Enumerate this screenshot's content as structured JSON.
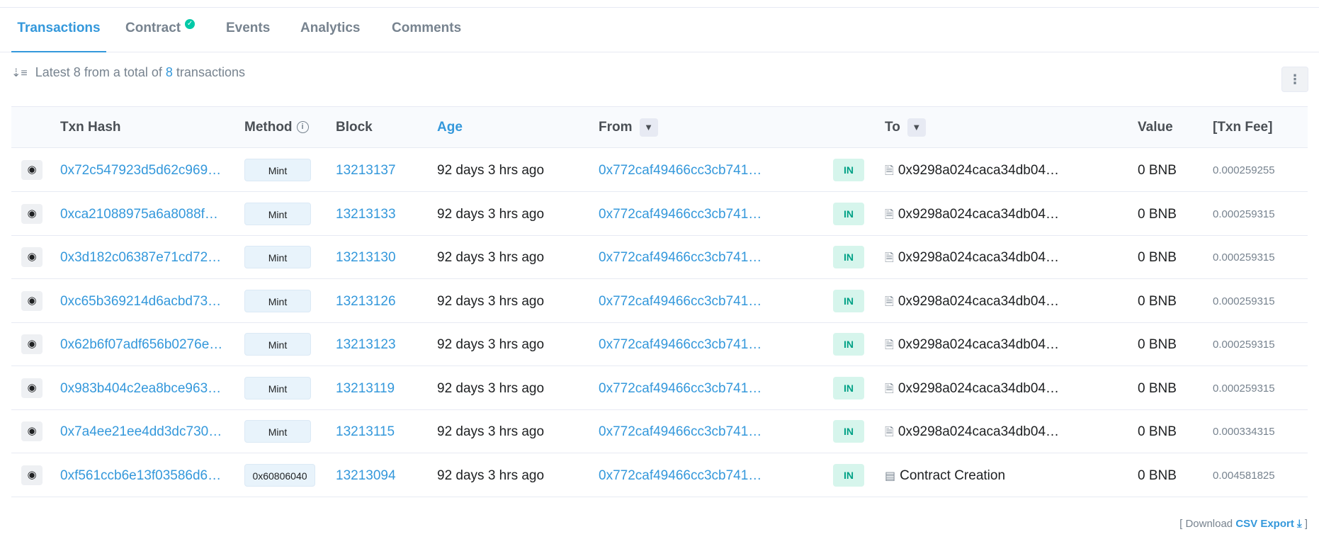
{
  "tabs": [
    {
      "label": "Transactions",
      "active": true
    },
    {
      "label": "Contract",
      "verified": true
    },
    {
      "label": "Events"
    },
    {
      "label": "Analytics"
    },
    {
      "label": "Comments"
    }
  ],
  "summary": {
    "prefix": "Latest 8 from a total of",
    "count": "8",
    "suffix": "transactions"
  },
  "more_icon": "⋮",
  "columns": {
    "txn_hash": "Txn Hash",
    "method": "Method",
    "block": "Block",
    "age": "Age",
    "from": "From",
    "to": "To",
    "value": "Value",
    "txn_fee": "[Txn Fee]"
  },
  "rows": [
    {
      "hash": "0x72c547923d5d62c969…",
      "method": "Mint",
      "block": "13213137",
      "age": "92 days 3 hrs ago",
      "from": "0x772caf49466cc3cb741…",
      "direction": "IN",
      "to": "0x9298a024caca34db04…",
      "to_icon": "file-icon",
      "value": "0 BNB",
      "fee": "0.000259255"
    },
    {
      "hash": "0xca21088975a6a8088f…",
      "method": "Mint",
      "block": "13213133",
      "age": "92 days 3 hrs ago",
      "from": "0x772caf49466cc3cb741…",
      "direction": "IN",
      "to": "0x9298a024caca34db04…",
      "to_icon": "file-icon",
      "value": "0 BNB",
      "fee": "0.000259315"
    },
    {
      "hash": "0x3d182c06387e71cd72…",
      "method": "Mint",
      "block": "13213130",
      "age": "92 days 3 hrs ago",
      "from": "0x772caf49466cc3cb741…",
      "direction": "IN",
      "to": "0x9298a024caca34db04…",
      "to_icon": "file-icon",
      "value": "0 BNB",
      "fee": "0.000259315"
    },
    {
      "hash": "0xc65b369214d6acbd73…",
      "method": "Mint",
      "block": "13213126",
      "age": "92 days 3 hrs ago",
      "from": "0x772caf49466cc3cb741…",
      "direction": "IN",
      "to": "0x9298a024caca34db04…",
      "to_icon": "file-icon",
      "value": "0 BNB",
      "fee": "0.000259315"
    },
    {
      "hash": "0x62b6f07adf656b0276e…",
      "method": "Mint",
      "block": "13213123",
      "age": "92 days 3 hrs ago",
      "from": "0x772caf49466cc3cb741…",
      "direction": "IN",
      "to": "0x9298a024caca34db04…",
      "to_icon": "file-icon",
      "value": "0 BNB",
      "fee": "0.000259315"
    },
    {
      "hash": "0x983b404c2ea8bce963…",
      "method": "Mint",
      "block": "13213119",
      "age": "92 days 3 hrs ago",
      "from": "0x772caf49466cc3cb741…",
      "direction": "IN",
      "to": "0x9298a024caca34db04…",
      "to_icon": "file-icon",
      "value": "0 BNB",
      "fee": "0.000259315"
    },
    {
      "hash": "0x7a4ee21ee4dd3dc730…",
      "method": "Mint",
      "block": "13213115",
      "age": "92 days 3 hrs ago",
      "from": "0x772caf49466cc3cb741…",
      "direction": "IN",
      "to": "0x9298a024caca34db04…",
      "to_icon": "file-icon",
      "value": "0 BNB",
      "fee": "0.000334315"
    },
    {
      "hash": "0xf561ccb6e13f03586d6…",
      "method": "0x60806040",
      "block": "13213094",
      "age": "92 days 3 hrs ago",
      "from": "0x772caf49466cc3cb741…",
      "direction": "IN",
      "to": "Contract Creation",
      "to_icon": "newspaper-icon",
      "value": "0 BNB",
      "fee": "0.004581825"
    }
  ],
  "footer": {
    "open": "[ Download",
    "csv_label": "CSV Export",
    "close": "]"
  },
  "colors": {
    "accent": "#3498db",
    "in_badge_bg": "#d6f5ec",
    "in_badge_text": "#00a186",
    "verified": "#00c9a7"
  }
}
